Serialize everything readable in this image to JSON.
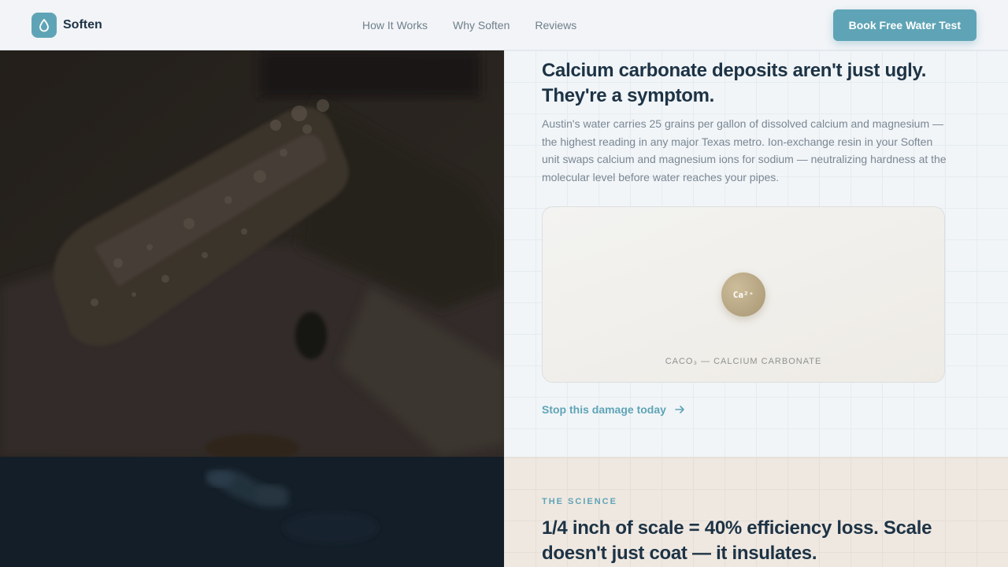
{
  "brand": {
    "name": "Soften",
    "icon": "droplet-icon",
    "accent": "#5fa4b6"
  },
  "nav": {
    "items": [
      {
        "label": "How It Works"
      },
      {
        "label": "Why Soften"
      },
      {
        "label": "Reviews"
      }
    ]
  },
  "header": {
    "cta_label": "Book Free Water Test"
  },
  "hero": {
    "headline": "Calcium carbonate deposits aren't just ugly. They're a symptom.",
    "body": "Austin's water carries 25 grains per gallon of dissolved calcium and magnesium — the highest reading in any major Texas metro. Ion-exchange resin in your Soften unit swaps calcium and magnesium ions for sodium — neutralizing hardness at the molecular level before water reaches your pipes.",
    "molecule": {
      "ion_label": "Ca²⁺",
      "caption": "CACO₃ — CALCIUM CARBONATE"
    },
    "link_label": "Stop this damage today",
    "link_icon": "arrow-right-icon"
  },
  "science": {
    "eyebrow": "THE SCIENCE",
    "headline": "1/4 inch of scale = 40% efficiency loss. Scale doesn't just coat — it insulates."
  }
}
